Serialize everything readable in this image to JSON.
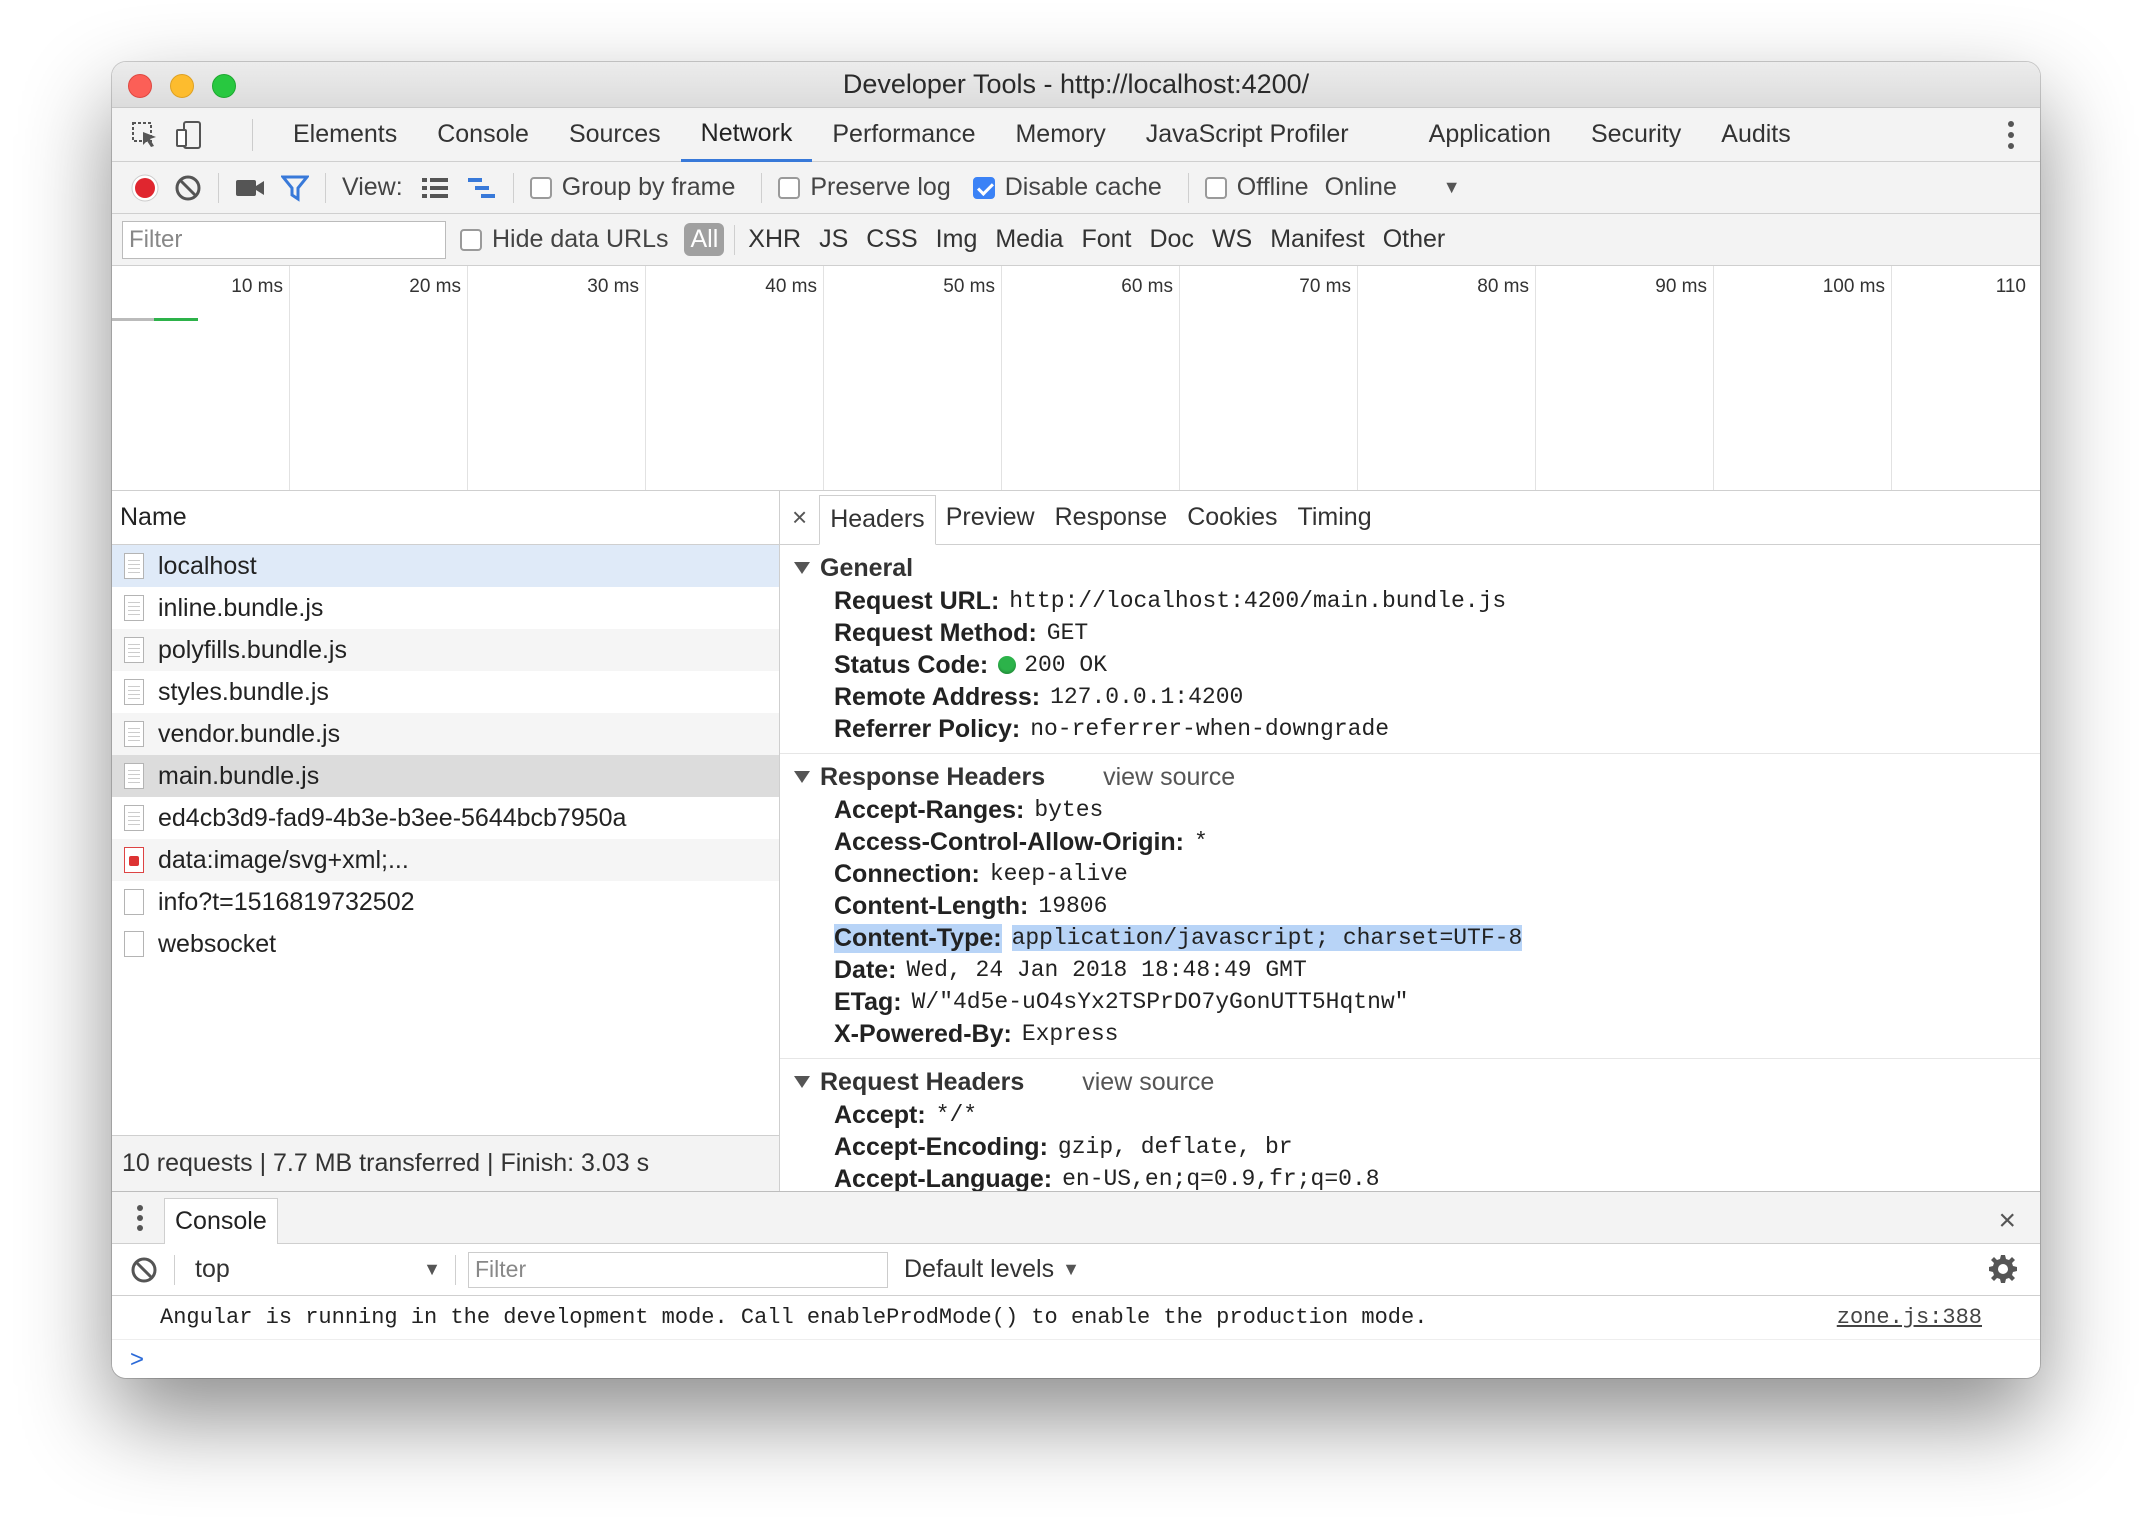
{
  "window": {
    "title": "Developer Tools - http://localhost:4200/"
  },
  "main_tabs": [
    {
      "label": "Elements"
    },
    {
      "label": "Console"
    },
    {
      "label": "Sources"
    },
    {
      "label": "Network"
    },
    {
      "label": "Performance"
    },
    {
      "label": "Memory"
    },
    {
      "label": "JavaScript Profiler"
    },
    {
      "label": "Application"
    },
    {
      "label": "Security"
    },
    {
      "label": "Audits"
    }
  ],
  "active_tab": "Network",
  "toolbar": {
    "view_label": "View:",
    "group_by_frame": "Group by frame",
    "preserve_log": "Preserve log",
    "disable_cache": "Disable cache",
    "offline": "Offline",
    "throttle": "Online"
  },
  "filterbar": {
    "placeholder": "Filter",
    "hide_data_urls": "Hide data URLs",
    "types": [
      "All",
      "XHR",
      "JS",
      "CSS",
      "Img",
      "Media",
      "Font",
      "Doc",
      "WS",
      "Manifest",
      "Other"
    ]
  },
  "timeline": {
    "ticks": [
      "10 ms",
      "20 ms",
      "30 ms",
      "40 ms",
      "50 ms",
      "60 ms",
      "70 ms",
      "80 ms",
      "90 ms",
      "100 ms",
      "110"
    ]
  },
  "requests": {
    "header": "Name",
    "rows": [
      {
        "name": "localhost"
      },
      {
        "name": "inline.bundle.js"
      },
      {
        "name": "polyfills.bundle.js"
      },
      {
        "name": "styles.bundle.js"
      },
      {
        "name": "vendor.bundle.js"
      },
      {
        "name": "main.bundle.js"
      },
      {
        "name": "ed4cb3d9-fad9-4b3e-b3ee-5644bcb7950a"
      },
      {
        "name": "data:image/svg+xml;..."
      },
      {
        "name": "info?t=1516819732502"
      },
      {
        "name": "websocket"
      }
    ],
    "summary": "10 requests | 7.7 MB transferred | Finish: 3.03 s"
  },
  "detail": {
    "close": "×",
    "tabs": [
      "Headers",
      "Preview",
      "Response",
      "Cookies",
      "Timing"
    ],
    "general": {
      "title": "General",
      "items": [
        {
          "k": "Request URL:",
          "v": "http://localhost:4200/main.bundle.js"
        },
        {
          "k": "Request Method:",
          "v": "GET"
        },
        {
          "k": "Status Code:",
          "v": "200 OK"
        },
        {
          "k": "Remote Address:",
          "v": "127.0.0.1:4200"
        },
        {
          "k": "Referrer Policy:",
          "v": "no-referrer-when-downgrade"
        }
      ]
    },
    "response_headers": {
      "title": "Response Headers",
      "view_source": "view source",
      "items": [
        {
          "k": "Accept-Ranges:",
          "v": "bytes"
        },
        {
          "k": "Access-Control-Allow-Origin:",
          "v": "*"
        },
        {
          "k": "Connection:",
          "v": "keep-alive"
        },
        {
          "k": "Content-Length:",
          "v": "19806"
        },
        {
          "k": "Content-Type:",
          "v": "application/javascript; charset=UTF-8"
        },
        {
          "k": "Date:",
          "v": "Wed, 24 Jan 2018 18:48:49 GMT"
        },
        {
          "k": "ETag:",
          "v": "W/\"4d5e-uO4sYx2TSPrDO7yGonUTT5Hqtnw\""
        },
        {
          "k": "X-Powered-By:",
          "v": "Express"
        }
      ]
    },
    "request_headers": {
      "title": "Request Headers",
      "view_source": "view source",
      "items": [
        {
          "k": "Accept:",
          "v": "*/*"
        },
        {
          "k": "Accept-Encoding:",
          "v": "gzip, deflate, br"
        },
        {
          "k": "Accept-Language:",
          "v": "en-US,en;q=0.9,fr;q=0.8"
        }
      ]
    }
  },
  "drawer": {
    "tab": "Console",
    "close": "×",
    "context": "top",
    "filter_placeholder": "Filter",
    "levels": "Default levels",
    "message": "Angular is running in the development mode. Call enableProdMode() to enable the production mode.",
    "message_source": "zone.js:388",
    "prompt": ">"
  },
  "colors": {
    "accent": "#3879d9",
    "record": "#e0262f",
    "status_ok": "#2cb34a",
    "selection": "#b8d4f7"
  }
}
